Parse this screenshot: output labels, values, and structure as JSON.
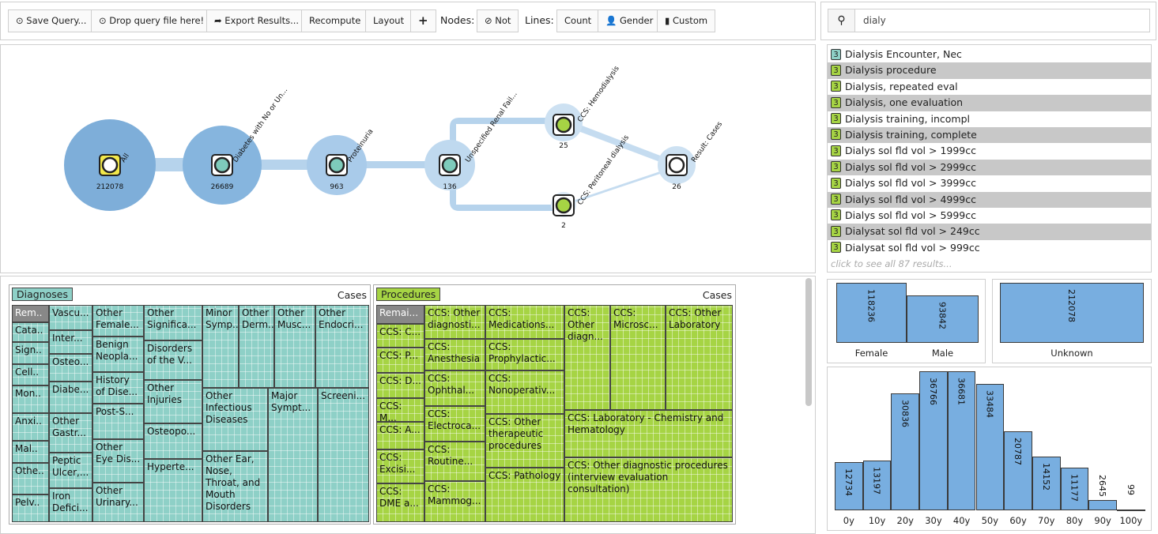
{
  "toolbar": {
    "save_label": "Save Query...",
    "drop_label": "Drop query file here!",
    "export_label": "Export Results...",
    "recompute_label": "Recompute",
    "layout_label": "Layout",
    "add_label": "+",
    "nodes_label": "Nodes:",
    "not_label": "Not",
    "lines_label": "Lines:",
    "count_label": "Count",
    "gender_label": "Gender",
    "custom_label": "Custom"
  },
  "search": {
    "value": "dialy",
    "placeholder": ""
  },
  "flow": {
    "nodes": [
      {
        "label": "All",
        "count": "212078"
      },
      {
        "label": "Diabetes with No or Un...",
        "count": "26689"
      },
      {
        "label": "Proteinuria",
        "count": "963"
      },
      {
        "label": "Unspecified Renal Fail...",
        "count": "136"
      },
      {
        "label": "CCS: Hemodialysis",
        "count": "25"
      },
      {
        "label": "CCS: Peritoneal dialysis",
        "count": "2"
      },
      {
        "label": "Result: Cases",
        "count": "26"
      }
    ]
  },
  "results": {
    "items": [
      "Dialysis Encounter, Nec",
      "Dialysis procedure",
      "Dialysis, repeated eval",
      "Dialysis, one evaluation",
      "Dialysis training, incompl",
      "Dialysis training, complete",
      "Dialys sol fld vol > 1999cc",
      "Dialys sol fld vol > 2999cc",
      "Dialys sol fld vol > 3999cc",
      "Dialys sol fld vol > 4999cc",
      "Dialys sol fld vol > 5999cc",
      "Dialysat sol fld vol > 249cc",
      "Dialysat sol fld vol > 999cc"
    ],
    "badge": "3",
    "more": "click to see all 87 results..."
  },
  "diagnoses": {
    "title": "Diagnoses",
    "cases_label": "Cases",
    "cells": [
      "Rem..",
      "Cata..",
      "Sign..",
      "Cell..",
      "Mon..",
      "Anxi..",
      "Mal..",
      "Othe..",
      "Pelv..",
      "Vascu...",
      "Inter...",
      "Osteo...",
      "Diabe...",
      "Other Gastr...",
      "Peptic Ulcer,...",
      "Iron Defici...",
      "Other Female...",
      "Benign Neopla...",
      "History of Dise...",
      "Post-S...",
      "Other Eye Dis...",
      "Other Urinary...",
      "Other Significa...",
      "Disorders of the V...",
      "Other Injuries",
      "Osteopo...",
      "Hyperte...",
      "Minor Symp...",
      "Other Derm...",
      "Other Musc...",
      "Other Endocri...",
      "Other Infectious Diseases",
      "Major Sympt...",
      "Screeni...",
      "Other Ear, Nose, Throat, and Mouth Disorders"
    ]
  },
  "procedures": {
    "title": "Procedures",
    "cases_label": "Cases",
    "cells": [
      "Remai...",
      "CCS: C...",
      "CCS: P...",
      "CCS: D...",
      "CCS: M...",
      "CCS: A...",
      "CCS: Excisi...",
      "CCS: DME a...",
      "CCS: Other diagnosti...",
      "CCS: Anesthesia",
      "CCS: Ophthal...",
      "CCS: Electroca...",
      "CCS: Routine...",
      "CCS: Mammog...",
      "CCS: Medications...",
      "CCS: Prophylactic...",
      "CCS: Nonoperativ...",
      "CCS: Other therapeutic procedures",
      "CCS: Pathology",
      "CCS: Other diagn...",
      "CCS: Microsc...",
      "CCS: Other Laboratory",
      "CCS: Laboratory - Chemistry and Hematology",
      "CCS: Other diagnostic procedures (interview evaluation consultation)"
    ]
  },
  "gender": {
    "bars": [
      {
        "label": "Female",
        "value": 118236
      },
      {
        "label": "Male",
        "value": 93842
      },
      {
        "label": "Unknown",
        "value": 212078
      }
    ]
  },
  "age": {
    "labels": [
      "0y",
      "10y",
      "20y",
      "30y",
      "40y",
      "50y",
      "60y",
      "70y",
      "80y",
      "90y",
      "100y"
    ],
    "values": [
      12734,
      13197,
      30836,
      36766,
      36681,
      33484,
      20787,
      14152,
      11177,
      2645,
      99
    ]
  },
  "colors": {
    "diag": "#8ed0c7",
    "proc": "#a6d444",
    "bar": "#78aee0",
    "flow": "#7eaed9"
  }
}
